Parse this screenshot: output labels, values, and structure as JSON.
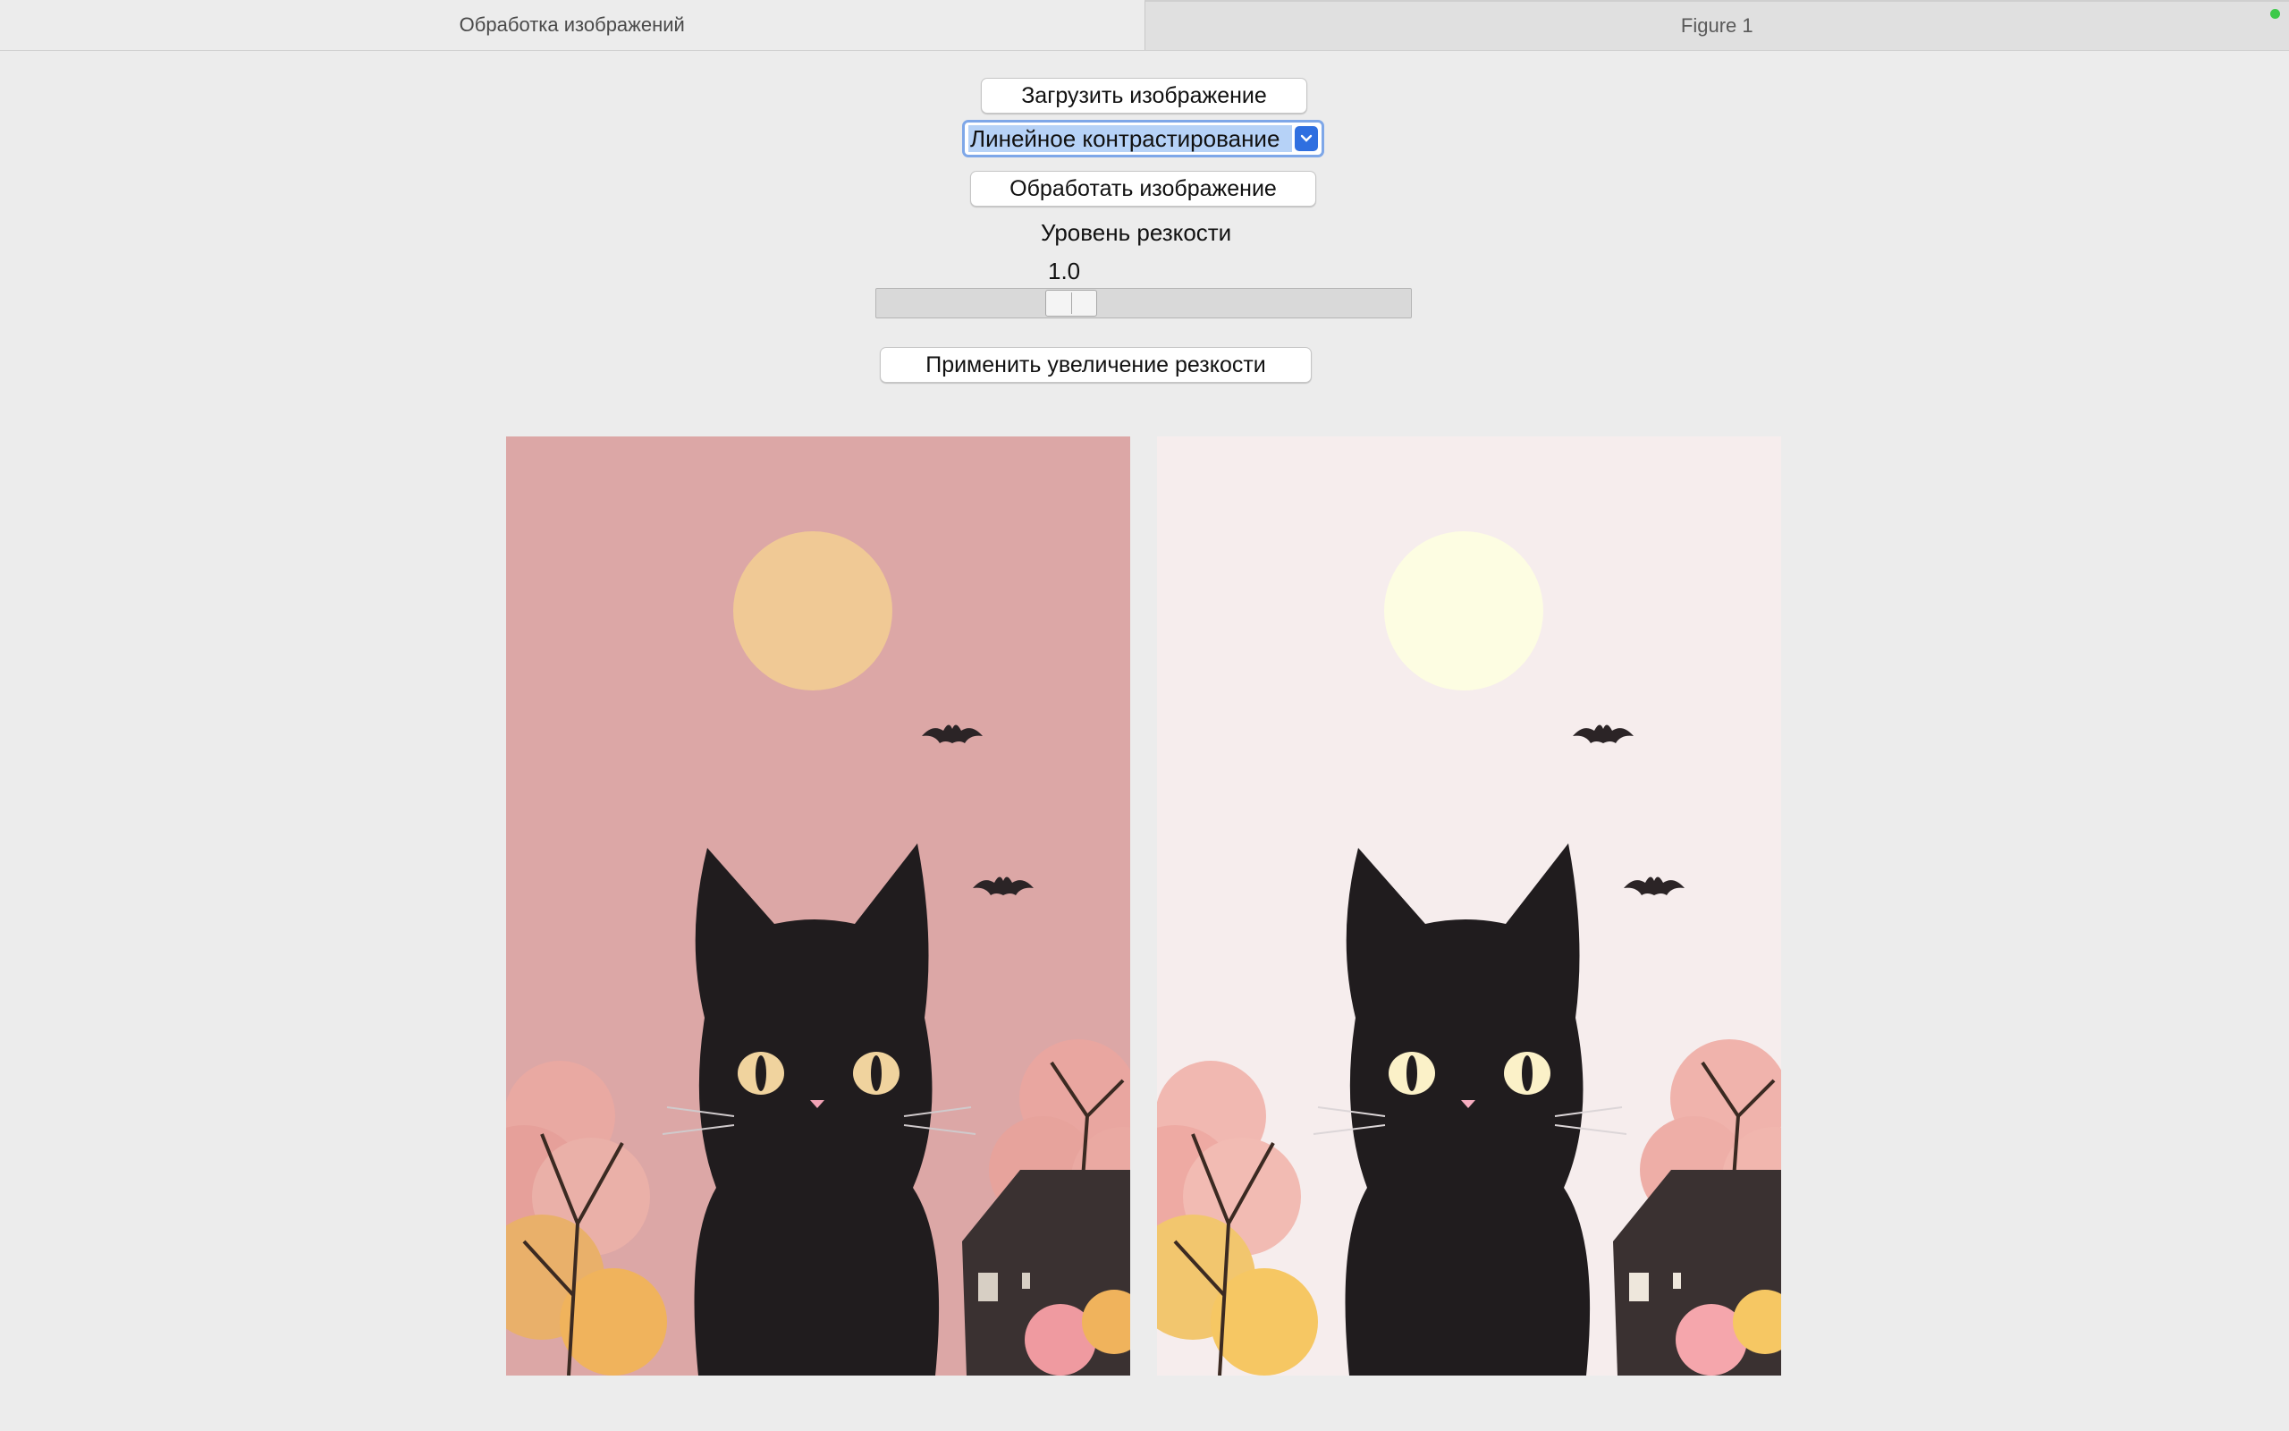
{
  "tabs": [
    {
      "label": "Обработка изображений",
      "active": true
    },
    {
      "label": "Figure 1",
      "active": false
    }
  ],
  "controls": {
    "load_button": "Загрузить изображение",
    "method_selected": "Линейное контрастирование",
    "process_button": "Обработать изображение",
    "sharpness_label": "Уровень резкости",
    "sharpness_value": "1.0",
    "sharpness_level": 0.35,
    "apply_sharpen_button": "Применить увеличение резкости"
  },
  "images": {
    "original": {
      "sky": "#dca7a6",
      "moon": "#f0c995"
    },
    "processed": {
      "sky": "#f6eded",
      "moon": "#fdfde2"
    }
  },
  "colors": {
    "accent": "#2f6fe0",
    "selection": "#b6d2f7",
    "status_dot": "#3dc94a"
  }
}
